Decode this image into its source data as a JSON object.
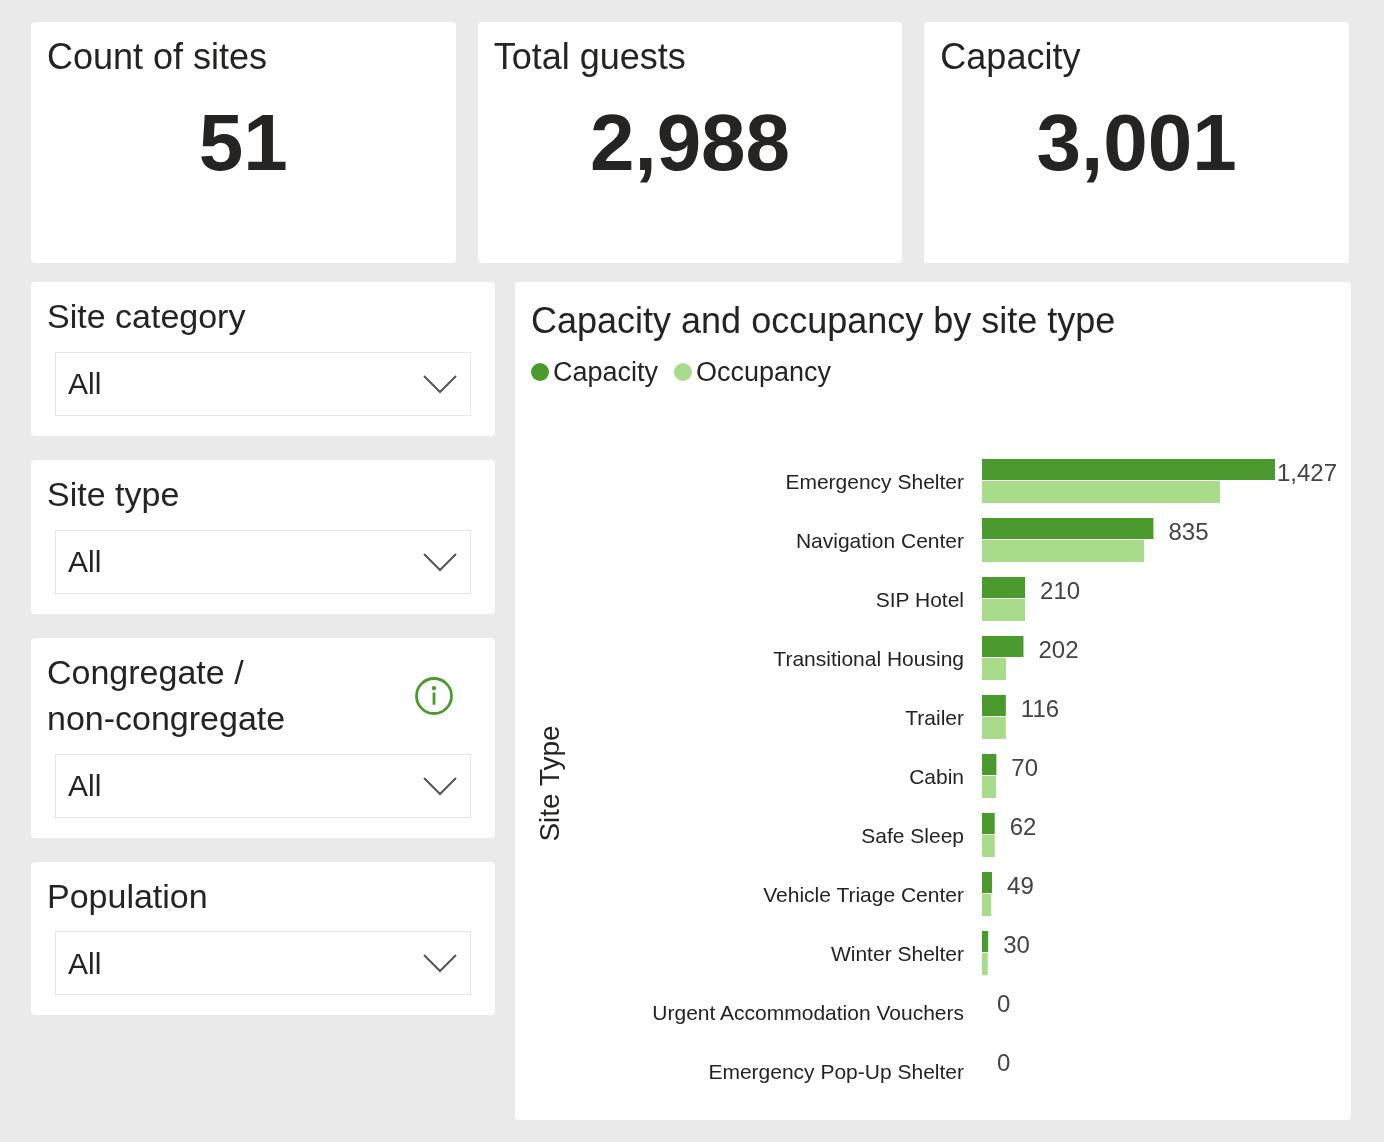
{
  "kpis": [
    {
      "title": "Count of sites",
      "value": "51"
    },
    {
      "title": "Total guests",
      "value": "2,988"
    },
    {
      "title": "Capacity",
      "value": "3,001"
    }
  ],
  "filters": [
    {
      "title": "Site category",
      "value": "All",
      "info": false
    },
    {
      "title": "Site type",
      "value": "All",
      "info": false
    },
    {
      "title": "Congregate / non-congregate",
      "value": "All",
      "info": true
    },
    {
      "title": "Population",
      "value": "All",
      "info": false
    }
  ],
  "chart": {
    "chart_data": {
      "type": "bar",
      "orientation": "horizontal",
      "title": "Capacity and occupancy by site type",
      "ylabel": "Site Type",
      "categories": [
        "Emergency Shelter",
        "Navigation Center",
        "SIP Hotel",
        "Transitional Housing",
        "Trailer",
        "Cabin",
        "Safe Sleep",
        "Vehicle Triage Center",
        "Winter Shelter",
        "Urgent Accommodation Vouchers",
        "Emergency Pop-Up Shelter"
      ],
      "series": [
        {
          "name": "Capacity",
          "color": "#4a9a2e",
          "values": [
            1427,
            835,
            210,
            202,
            116,
            70,
            62,
            49,
            30,
            0,
            0
          ],
          "value_labels": [
            "1,427",
            "835",
            "210",
            "202",
            "116",
            "70",
            "62",
            "49",
            "30",
            "0",
            "0"
          ]
        },
        {
          "name": "Occupancy",
          "color": "#a8dc8a",
          "values": [
            1159,
            790,
            210,
            117,
            116,
            68,
            62,
            45,
            28,
            0,
            0
          ]
        }
      ]
    }
  }
}
